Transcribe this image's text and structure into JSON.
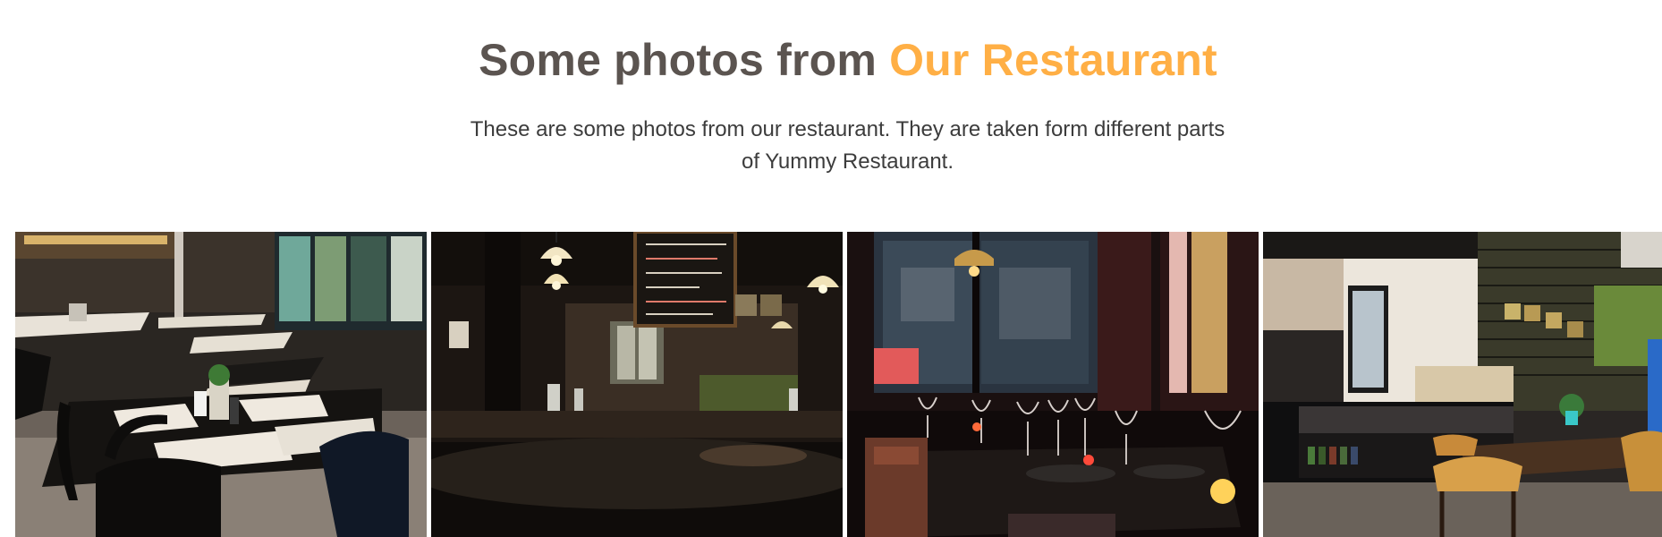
{
  "header": {
    "title_main": "Some photos from ",
    "title_accent": "Our Restaurant",
    "subtitle": "These are some photos from our restaurant. They are taken form different parts of Yummy Restaurant."
  },
  "colors": {
    "title": "#5b5450",
    "accent": "#ffaf45",
    "text": "#3c3c3c"
  }
}
